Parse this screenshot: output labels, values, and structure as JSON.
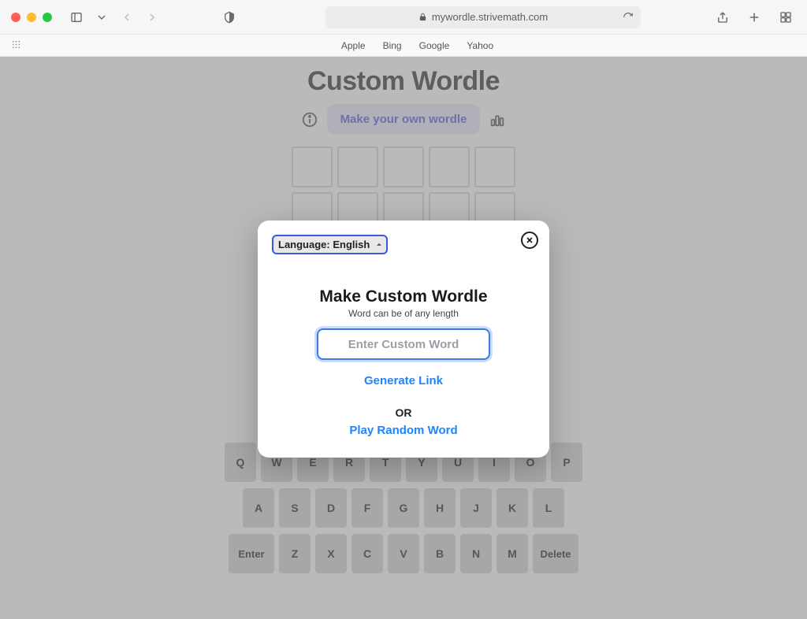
{
  "browser": {
    "url": "mywordle.strivemath.com",
    "favorites": [
      "Apple",
      "Bing",
      "Google",
      "Yahoo"
    ]
  },
  "page": {
    "title": "Custom Wordle",
    "makeOwnLabel": "Make your own wordle"
  },
  "keyboard": {
    "row1": [
      "Q",
      "W",
      "E",
      "R",
      "T",
      "Y",
      "U",
      "I",
      "O",
      "P"
    ],
    "row2": [
      "A",
      "S",
      "D",
      "F",
      "G",
      "H",
      "J",
      "K",
      "L"
    ],
    "row3": [
      "Enter",
      "Z",
      "X",
      "C",
      "V",
      "B",
      "N",
      "M",
      "Delete"
    ]
  },
  "modal": {
    "langLabel": "Language: English",
    "title": "Make Custom Wordle",
    "subtitle": "Word can be of any length",
    "inputPlaceholder": "Enter Custom Word",
    "generate": "Generate Link",
    "or": "OR",
    "random": "Play Random Word",
    "close": "✕"
  }
}
